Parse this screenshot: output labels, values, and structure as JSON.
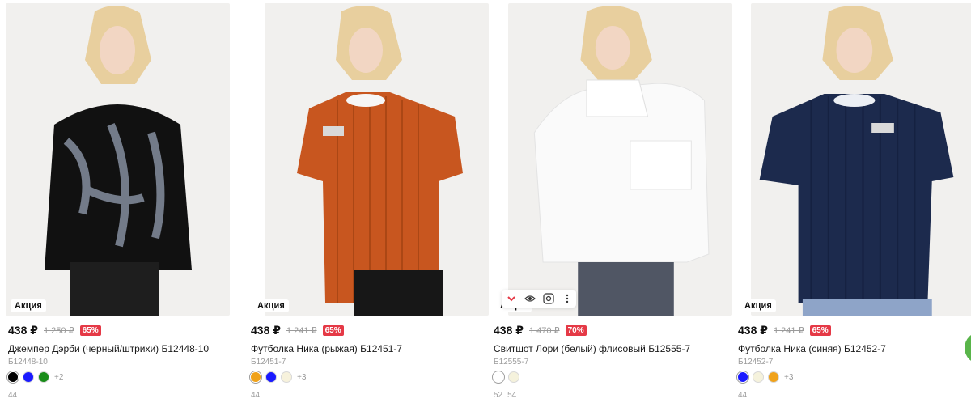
{
  "products": [
    {
      "badge": "Акция",
      "price": "438 ₽",
      "old_price": "1 250 ₽",
      "discount": "65%",
      "title": "Джемпер Дэрби (черный/штрихи) Б12448-10",
      "sku": "Б12448-10",
      "swatches": [
        "#000000",
        "#1a1aff",
        "#198c19"
      ],
      "more_colors": "+2",
      "sizes": [
        "44"
      ]
    },
    {
      "badge": "Акция",
      "price": "438 ₽",
      "old_price": "1 241 ₽",
      "discount": "65%",
      "title": "Футболка Ника (рыжая) Б12451-7",
      "sku": "Б12451-7",
      "swatches": [
        "#f0a21a",
        "#1a1aff",
        "#f7f2dc"
      ],
      "more_colors": "+3",
      "sizes": [
        "44"
      ]
    },
    {
      "badge": "Акция",
      "price": "438 ₽",
      "old_price": "1 470 ₽",
      "discount": "70%",
      "title": "Свитшот Лори (белый) флисовый Б12555-7",
      "sku": "Б12555-7",
      "swatches": [
        "#ffffff",
        "#f5f2dc"
      ],
      "more_colors": "",
      "sizes": [
        "52",
        "54"
      ]
    },
    {
      "badge": "Акция",
      "price": "438 ₽",
      "old_price": "1 241 ₽",
      "discount": "65%",
      "title": "Футболка Ника (синяя) Б12452-7",
      "sku": "Б12452-7",
      "swatches": [
        "#1a1aff",
        "#f5f2dc",
        "#f0a21a"
      ],
      "more_colors": "+3",
      "sizes": [
        "44"
      ]
    }
  ],
  "hover_tools": [
    "chevron-down-icon",
    "eye-icon",
    "camera-search-icon",
    "more-vertical-icon"
  ],
  "colors": {
    "discount_bg": "#e53946",
    "accent_green": "#59b54a"
  }
}
